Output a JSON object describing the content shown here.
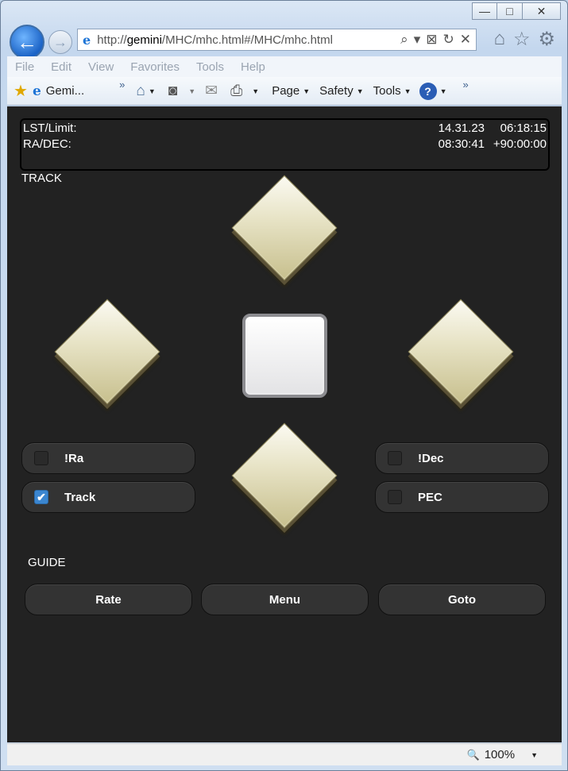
{
  "browser": {
    "window_buttons": {
      "minimize": "—",
      "restore": "□",
      "close": "✕"
    },
    "back_glyph": "←",
    "forward_glyph": "→",
    "address": {
      "prefix": "http://",
      "host": "gemini",
      "path": "/MHC/mhc.html#/MHC/mhc.html"
    },
    "address_tools": [
      "⌕",
      "▾",
      "⊠",
      "↻",
      "✕"
    ],
    "nav_icons": [
      "⌂",
      "☆",
      "⚙"
    ],
    "menu": [
      "File",
      "Edit",
      "View",
      "Favorites",
      "Tools",
      "Help"
    ],
    "tab_label": "Gemi...",
    "command_items": [
      "Page",
      "Safety",
      "Tools"
    ],
    "zoom": "100%"
  },
  "status": {
    "lst_label": "LST/Limit:",
    "lst_value": "14.31.23",
    "limit_value": "06:18:15",
    "radec_label": "RA/DEC:",
    "ra_value": "08:30:41",
    "dec_value": "+90:00:00"
  },
  "sections": {
    "track": "TRACK",
    "guide": "GUIDE"
  },
  "toggles": [
    {
      "label": "!Ra",
      "checked": false
    },
    {
      "label": "Track",
      "checked": true
    },
    {
      "label": "!Dec",
      "checked": false
    },
    {
      "label": "PEC",
      "checked": false
    }
  ],
  "buttons": {
    "rate": "Rate",
    "menu": "Menu",
    "goto": "Goto"
  }
}
